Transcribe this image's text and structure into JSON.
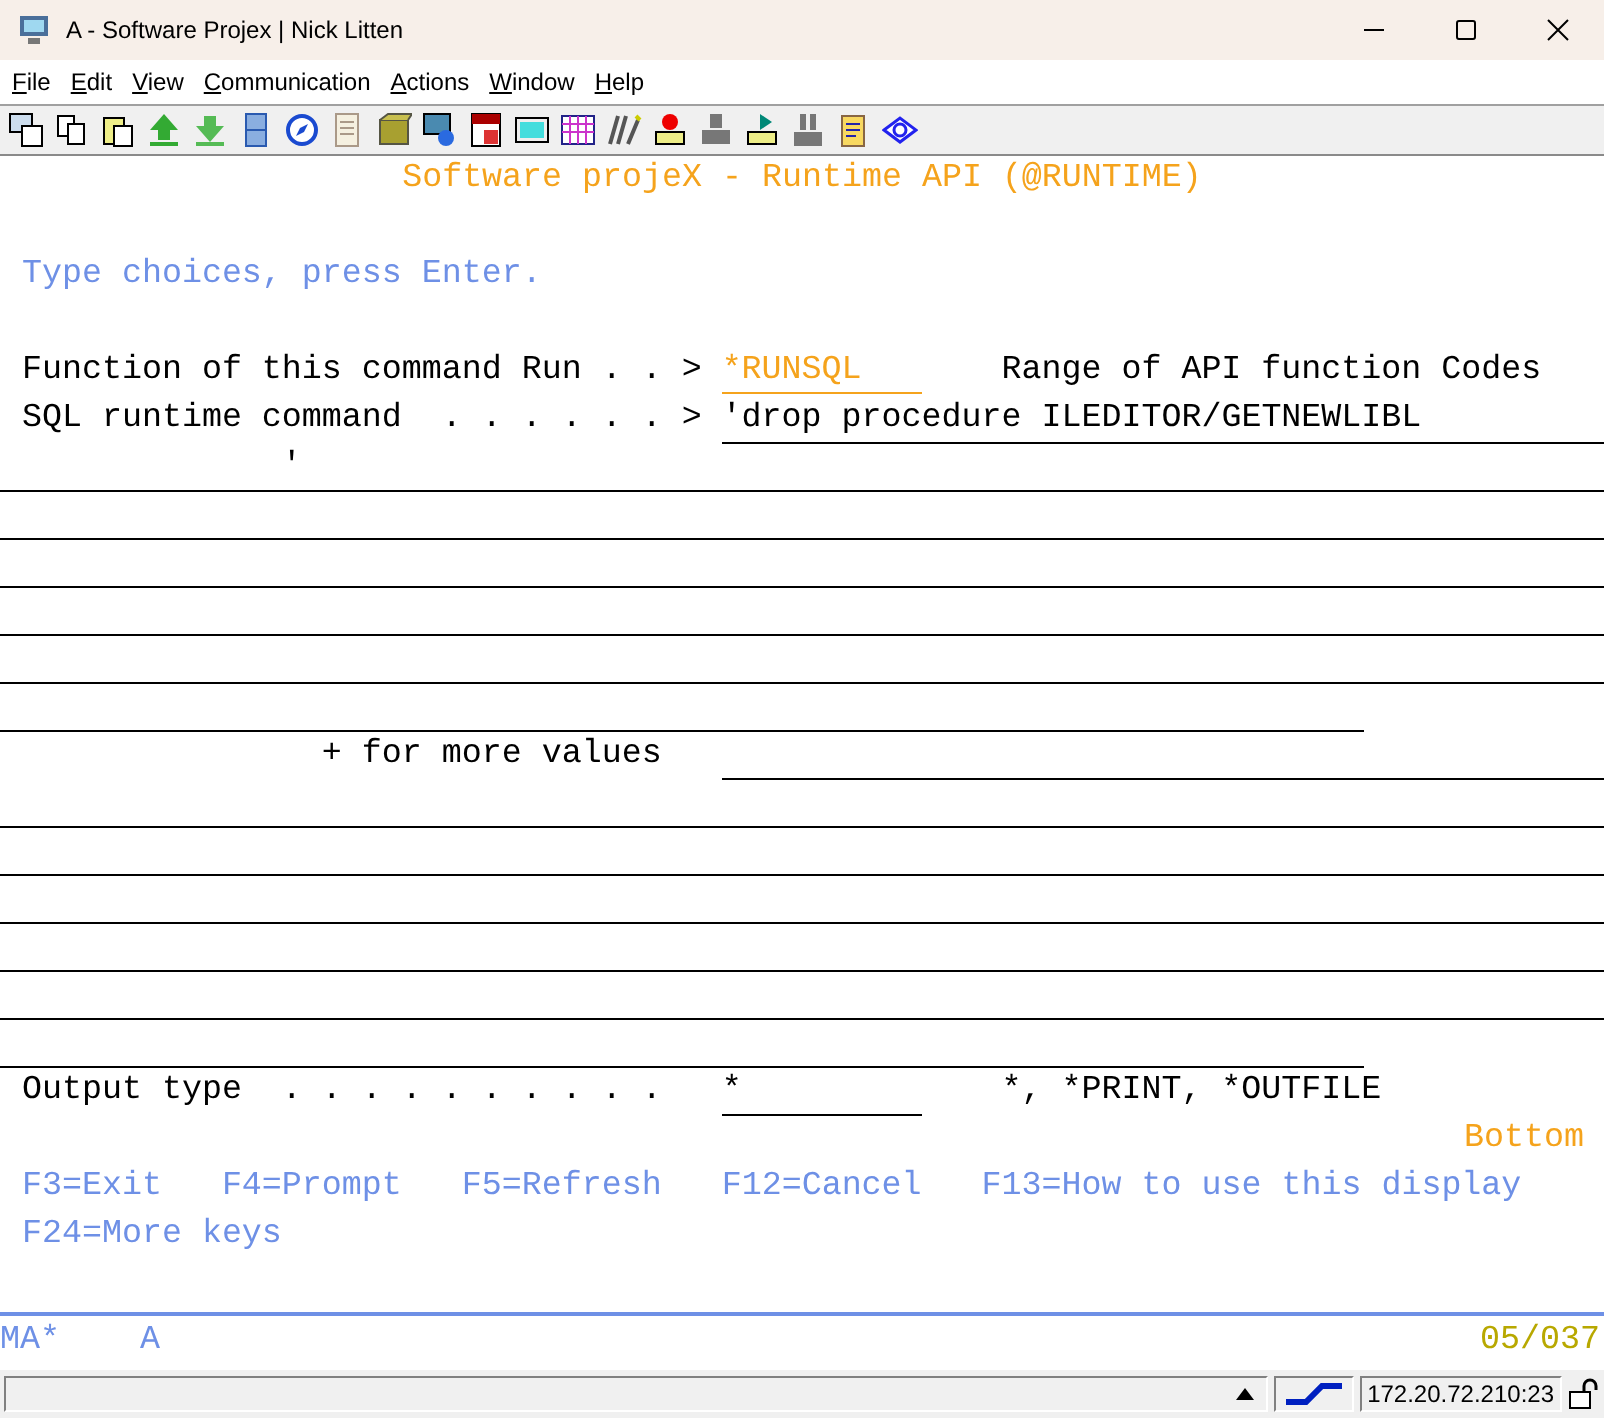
{
  "window": {
    "title": "A - Software Projex | Nick Litten"
  },
  "menu": [
    {
      "label": "File"
    },
    {
      "label": "Edit"
    },
    {
      "label": "View"
    },
    {
      "label": "Communication"
    },
    {
      "label": "Actions"
    },
    {
      "label": "Window"
    },
    {
      "label": "Help"
    }
  ],
  "screen": {
    "title": "Software projeX - Runtime API (@RUNTIME)",
    "instruction": "Type choices, press Enter.",
    "function_field": {
      "label": "Function of this command Run . . >",
      "value": "*RUNSQL",
      "hint": "Range of API function Codes",
      "highlighted": true
    },
    "sql_field": {
      "label": "SQL runtime command  . . . . . . >",
      "value": "'drop procedure ILEDITOR/GETNEWLIBL",
      "continuation": "'"
    },
    "more_values": {
      "label": "+ for more values"
    },
    "output_field": {
      "label": "Output type  . . . . . . . . . .",
      "value": "*",
      "hint": "*, *PRINT, *OUTFILE",
      "highlighted": false
    },
    "position": "Bottom",
    "function_keys": [
      [
        "F3=Exit",
        "F4=Prompt",
        "F5=Refresh",
        "F12=Cancel",
        "F13=How to use this display"
      ],
      [
        "F24=More keys"
      ]
    ]
  },
  "status_line": {
    "mode": "MA*",
    "session": "A",
    "cursor": "05/037"
  },
  "status_bar": {
    "address": "172.20.72.210:23"
  }
}
